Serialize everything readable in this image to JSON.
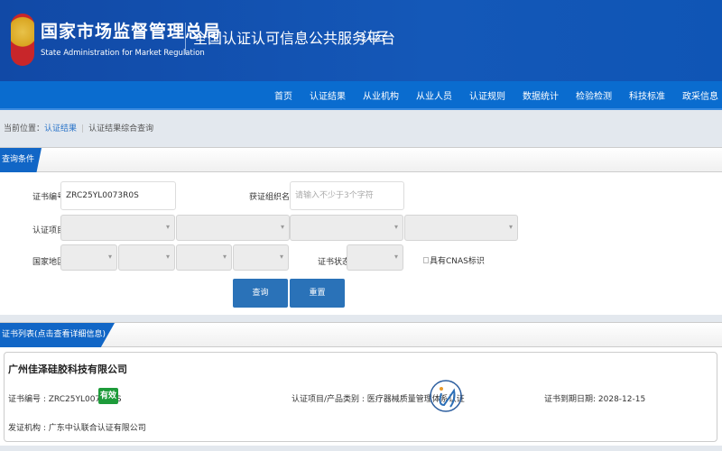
{
  "header": {
    "org_cn": "国家市场监督管理总局",
    "org_en": "State Administration  for  Market Regulation",
    "platform": "全国认证认可信息公共服务平台",
    "platform_logo": "认云"
  },
  "nav": [
    "首页",
    "认证结果",
    "从业机构",
    "从业人员",
    "认证规则",
    "数据统计",
    "检验检测",
    "科技标准",
    "政采信息"
  ],
  "breadcrumb": {
    "prefix": "当前位置：",
    "link": "认证结果",
    "current": "认证结果综合查询"
  },
  "query": {
    "tab": "查询条件",
    "cert_no_label": "证书编号:",
    "cert_no_value": "ZRC25YL0073R0S",
    "org_label": "获证组织名称:",
    "org_placeholder": "请输入不少于3个字符",
    "project_label": "认证项目:",
    "region_label": "国家地区:",
    "status_label": "证书状态:",
    "cnas_label": "具有CNAS标识",
    "search_btn": "查询",
    "reset_btn": "重置"
  },
  "results": {
    "tab": "证书列表(点击查看详细信息)",
    "items": [
      {
        "company": "广州佳泽硅胶科技有限公司",
        "cert_no": "证书编号 : ZRC25YL0073R0S",
        "status": "有效",
        "status_color": "#1e9b3a",
        "project": "认证项目/产品类别 : 医疗器械质量管理体系认证",
        "expiry": "证书到期日期: 2028-12-15",
        "issuer": "发证机构 : 广东中认联合认证有限公司"
      }
    ]
  }
}
